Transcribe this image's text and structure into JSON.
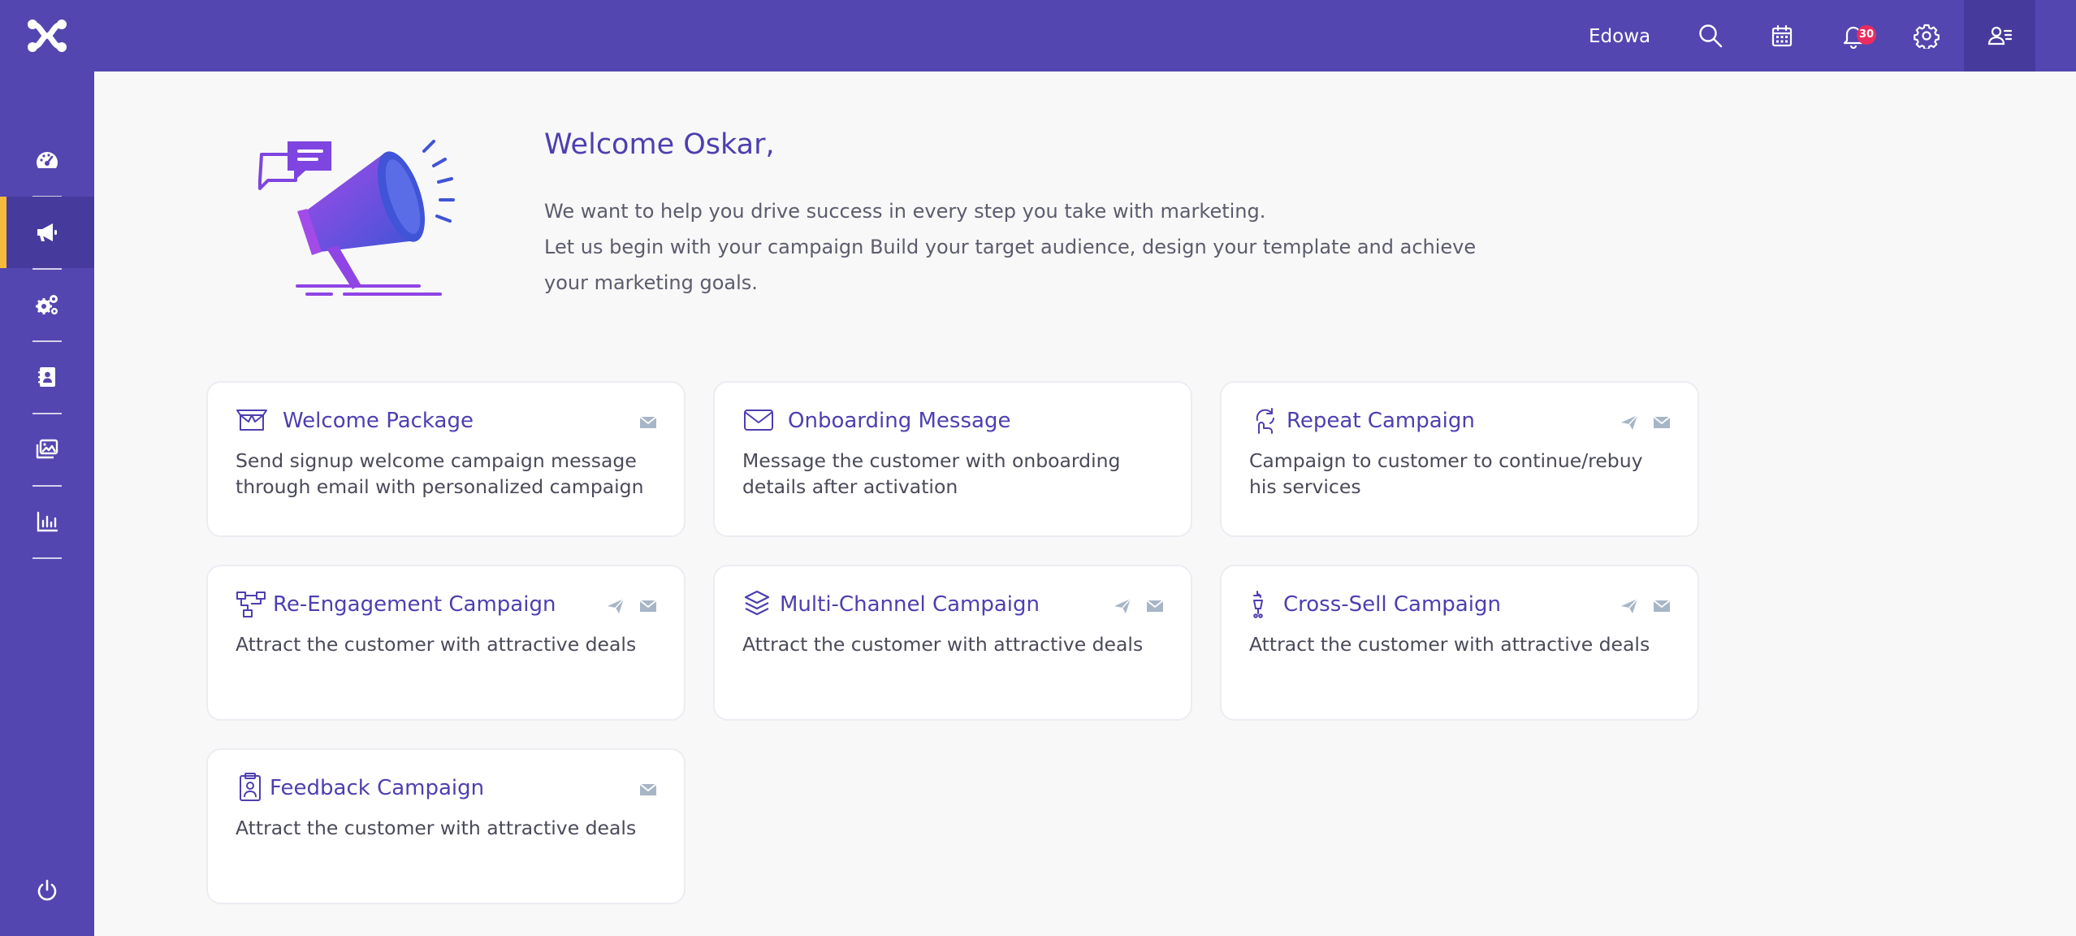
{
  "topbar": {
    "user_name": "Edowa",
    "notification_count": "30",
    "icons": [
      "search-icon",
      "calendar-icon",
      "bell-icon",
      "gear-icon",
      "user-list-icon"
    ]
  },
  "sidebar": {
    "items": [
      "dashboard-icon",
      "megaphone-icon",
      "cogs-icon",
      "contacts-icon",
      "images-icon",
      "chart-icon"
    ],
    "active_index": 1,
    "bottom": "power-icon"
  },
  "welcome": {
    "title": "Welcome Oskar,",
    "line1": "We want to help you drive success in every step you take with marketing.",
    "line2": "Let us begin with your campaign Build your target audience, design your template and achieve your marketing goals."
  },
  "cards": [
    {
      "title": "Welcome Package",
      "description": "Send signup welcome campaign message through email with personalized campaign",
      "icon": "open-box-icon",
      "channels": [
        "email"
      ]
    },
    {
      "title": "Onboarding Message",
      "description": "Message the customer with onboarding details after activation",
      "icon": "envelope-outline-icon",
      "channels": []
    },
    {
      "title": "Repeat Campaign",
      "description": "Campaign to customer to continue/rebuy his services",
      "icon": "repeat-hand-icon",
      "channels": [
        "send",
        "email"
      ]
    },
    {
      "title": "Re-Engagement Campaign",
      "description": "Attract the customer with attractive deals",
      "icon": "flow-icon",
      "channels": [
        "send",
        "email"
      ]
    },
    {
      "title": "Multi-Channel Campaign",
      "description": "Attract the customer with attractive deals",
      "icon": "layers-icon",
      "channels": [
        "send",
        "email"
      ]
    },
    {
      "title": "Cross-Sell Campaign",
      "description": "Attract the customer with attractive deals",
      "icon": "cart-icon",
      "channels": [
        "send",
        "email"
      ]
    },
    {
      "title": "Feedback Campaign",
      "description": "Attract the customer with attractive deals",
      "icon": "clipboard-icon",
      "channels": [
        "email"
      ]
    }
  ],
  "colors": {
    "brand": "#5346b0",
    "brand_dark": "#463b9d",
    "accent": "#f6b93b",
    "title_text": "#4d3fb0",
    "badge": "#ea2d5e",
    "channel_icon": "#a7b6c6"
  }
}
